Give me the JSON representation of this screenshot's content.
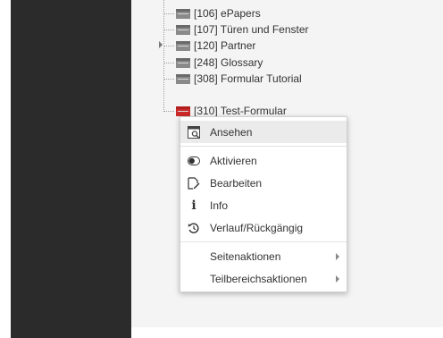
{
  "tree": {
    "items": [
      {
        "label": "[106] ePapers",
        "icon": "page-icon",
        "expandable": false
      },
      {
        "label": "[107] Türen und Fenster",
        "icon": "page-icon",
        "expandable": false
      },
      {
        "label": "[120] Partner",
        "icon": "page-icon",
        "expandable": true
      },
      {
        "label": "[248] Glossary",
        "icon": "page-icon",
        "expandable": false
      },
      {
        "label": "[308] Formular Tutorial",
        "icon": "page-icon",
        "expandable": false
      },
      {
        "label": "[310] Test-Formular",
        "icon": "form-page-icon",
        "expandable": false
      }
    ]
  },
  "context_menu": {
    "view": {
      "label": "Ansehen",
      "icon": "view-page-icon"
    },
    "activate": {
      "label": "Aktivieren",
      "icon": "toggle-icon"
    },
    "edit": {
      "label": "Bearbeiten",
      "icon": "edit-icon"
    },
    "info": {
      "label": "Info",
      "icon": "info-icon"
    },
    "history": {
      "label": "Verlauf/Rückgängig",
      "icon": "history-undo-icon"
    },
    "page_actions": {
      "label": "Seitenaktionen"
    },
    "section_actions": {
      "label": "Teilbereichsaktionen"
    }
  },
  "colors": {
    "sidebar": "#2b2b2b",
    "tree_background": "#f4f4f4",
    "form_icon": "#cc2a2a"
  }
}
